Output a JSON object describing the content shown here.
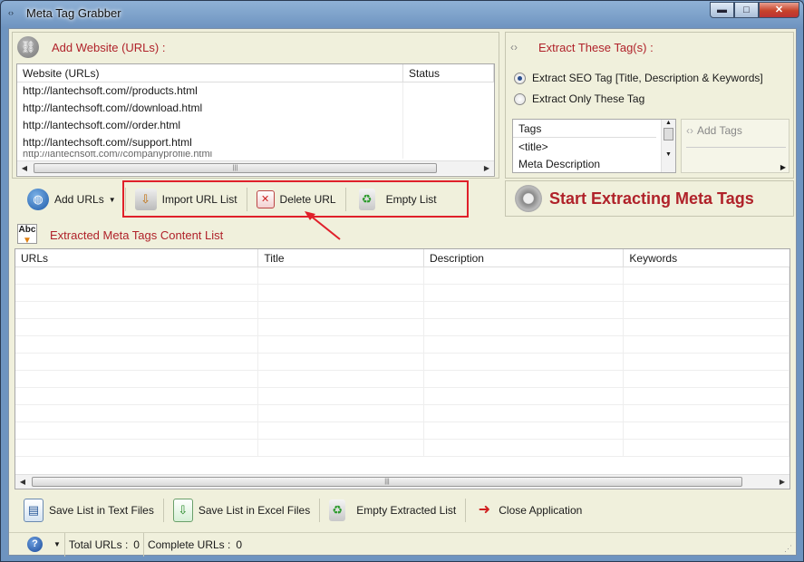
{
  "window": {
    "title": "Meta Tag Grabber",
    "minimize_label": "▬",
    "maximize_label": "□",
    "close_label": "✕"
  },
  "add_website": {
    "title": "Add Website (URLs) :",
    "columns": [
      "Website (URLs)",
      "Status"
    ],
    "rows": [
      {
        "url": "http://lantechsoft.com//products.html",
        "status": ""
      },
      {
        "url": "http://lantechsoft.com//download.html",
        "status": ""
      },
      {
        "url": "http://lantechsoft.com//order.html",
        "status": ""
      },
      {
        "url": "http://lantechsoft.com//support.html",
        "status": ""
      },
      {
        "url": "http://lantechsoft.com//companyprofile.html",
        "status": ""
      }
    ]
  },
  "url_toolbar": {
    "add_urls": "Add URLs",
    "import_url_list": "Import URL List",
    "delete_url": "Delete URL",
    "empty_list": "Empty List"
  },
  "extract_tags": {
    "title": "Extract These Tag(s) :",
    "option_seo": "Extract SEO Tag [Title, Description & Keywords]",
    "option_only": "Extract Only These Tag",
    "selected": "option_seo",
    "tags_header": "Tags",
    "tags": [
      "<title>",
      "Meta Description"
    ],
    "add_tags": "Add Tags",
    "start_button": "Start Extracting Meta Tags"
  },
  "extracted": {
    "title": "Extracted Meta Tags Content List",
    "columns": [
      "URLs",
      "Title",
      "Description",
      "Keywords"
    ]
  },
  "bottom_toolbar": {
    "save_text": "Save List in Text Files",
    "save_excel": "Save List in Excel Files",
    "empty_extracted": "Empty Extracted List",
    "close_app": "Close Application"
  },
  "status": {
    "total_urls_label": "Total URLs :",
    "total_urls_value": "0",
    "complete_urls_label": "Complete URLs :",
    "complete_urls_value": "0",
    "help_icon_text": "?"
  },
  "colors": {
    "accent_red": "#b0222a",
    "highlight_red": "#e0202a",
    "background": "#f0f0dc"
  }
}
